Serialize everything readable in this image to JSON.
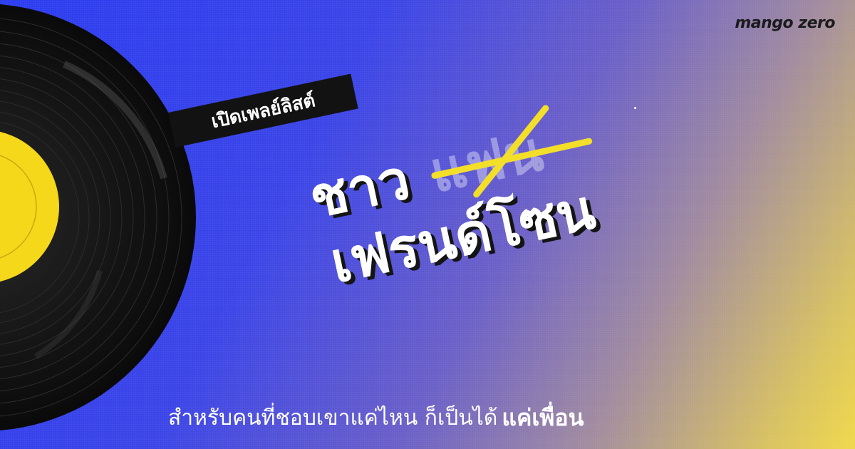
{
  "brand": {
    "logo_text": "mango zero"
  },
  "tag": {
    "label": "เปิดเพลย์ลิสต์"
  },
  "headline": {
    "word1": "ชาว",
    "crossed_word": "แฟน",
    "word2": "เฟรนด์โซน"
  },
  "subtitle": {
    "text": "สำหรับคนที่ชอบเขาแค่ไหน ก็เป็นได้",
    "emphasis": "แค่เพื่อน"
  },
  "colors": {
    "gradient_start": "#2b3cf0",
    "gradient_end": "#f0d84a",
    "record": "#111111",
    "label": "#f5d81a",
    "strike": "#f3df2a"
  }
}
